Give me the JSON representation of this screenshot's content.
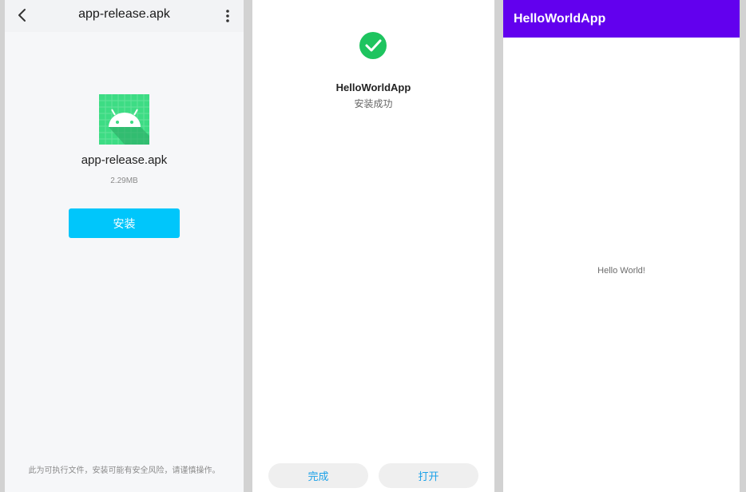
{
  "installer": {
    "title": "app-release.apk",
    "file_name": "app-release.apk",
    "file_size": "2.29MB",
    "install_label": "安装",
    "warning": "此为可执行文件，安装可能有安全风险，请谨慎操作。",
    "icons": {
      "back": "chevron-left-icon",
      "more": "more-vertical-icon",
      "app": "android-icon"
    }
  },
  "result": {
    "app_name": "HelloWorldApp",
    "status": "安装成功",
    "done_label": "完成",
    "open_label": "打开",
    "icons": {
      "success": "check-circle-icon"
    },
    "colors": {
      "success": "#1ec45f",
      "action": "#1ba1e8"
    }
  },
  "app": {
    "title": "HelloWorldApp",
    "content": "Hello World!",
    "colors": {
      "appbar": "#6200ee"
    }
  },
  "colors": {
    "install_button": "#00c6fb"
  }
}
